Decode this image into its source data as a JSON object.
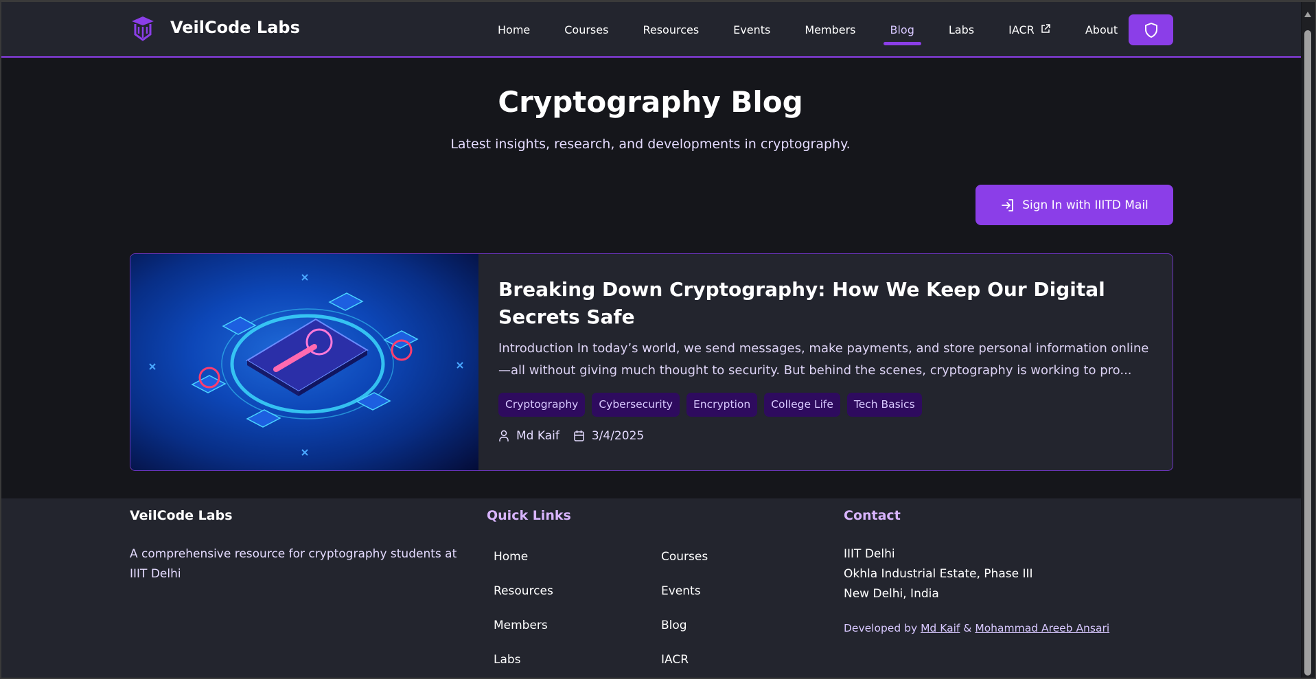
{
  "brand": {
    "name": "VeilCode Labs"
  },
  "nav": {
    "items": [
      {
        "label": "Home"
      },
      {
        "label": "Courses"
      },
      {
        "label": "Resources"
      },
      {
        "label": "Events"
      },
      {
        "label": "Members"
      },
      {
        "label": "Blog",
        "active": true
      },
      {
        "label": "Labs"
      },
      {
        "label": "IACR",
        "external": true
      },
      {
        "label": "About"
      }
    ],
    "admin_icon": "shield-icon"
  },
  "page": {
    "title": "Cryptography Blog",
    "subtitle": "Latest insights, research, and developments in cryptography.",
    "signin_label": "Sign In with IIITD Mail"
  },
  "post": {
    "title": "Breaking Down Cryptography: How We Keep Our Digital Secrets Safe",
    "excerpt": "Introduction In today’s world, we send messages, make payments, and store personal information online—all without giving much thought to security. But behind the scenes, cryptography is working to pro...",
    "tags": [
      "Cryptography",
      "Cybersecurity",
      "Encryption",
      "College Life",
      "Tech Basics"
    ],
    "author": "Md Kaif",
    "date": "3/4/2025"
  },
  "footer": {
    "about": {
      "title": "VeilCode Labs",
      "text": "A comprehensive resource for cryptography students at IIIT Delhi"
    },
    "quick_links": {
      "title": "Quick Links",
      "items": [
        "Home",
        "Courses",
        "Resources",
        "Events",
        "Members",
        "Blog",
        "Labs",
        "IACR"
      ]
    },
    "contact": {
      "title": "Contact",
      "lines": [
        "IIIT Delhi",
        "Okhla Industrial Estate, Phase III",
        "New Delhi, India"
      ],
      "developed_by": "Developed by",
      "dev1": "Md Kaif",
      "amp": "&",
      "dev2": "Mohammad Areeb Ansari"
    }
  },
  "colors": {
    "accent": "#8b3ee8",
    "tag_bg": "#2e0b5e",
    "heading_accent": "#d8b4fe",
    "surface": "#23252e",
    "background": "#15161b"
  }
}
